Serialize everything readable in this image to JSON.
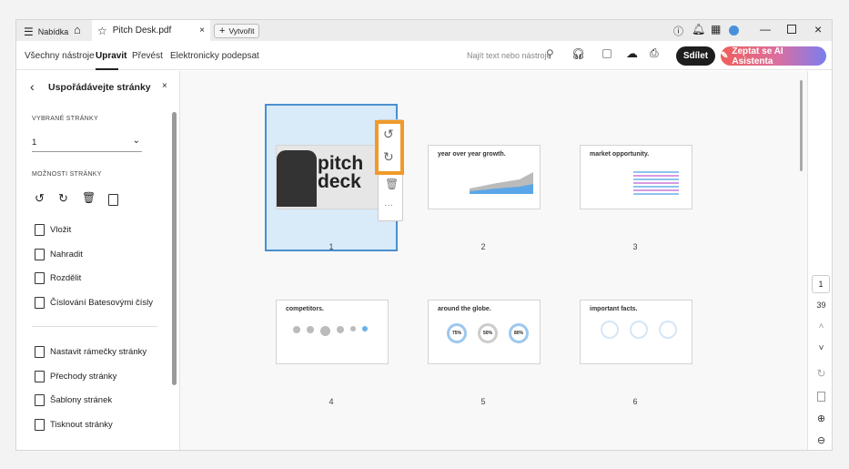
{
  "titlebar": {
    "menu_label": "Nabídka",
    "tab_title": "Pitch Desk.pdf",
    "create_label": "Vytvořit"
  },
  "toolbar": {
    "tabs": [
      "Všechny nástroje",
      "Upravit",
      "Převést",
      "Elektronicky podepsat"
    ],
    "active_tab": "Upravit",
    "search_placeholder": "Najít text nebo nástroje",
    "share_label": "Sdílet",
    "ai_label": "Zeptat se AI Asistenta",
    "ai_color": "#e8605a"
  },
  "panel": {
    "title": "Uspořádávejte stránky",
    "selected_label": "VYBRANÉ STRÁNKY",
    "selected_value": "1",
    "options_label": "MOŽNOSTI STRÁNKY",
    "items": [
      "Vložit",
      "Nahradit",
      "Rozdělit",
      "Číslování Batesovými čísly"
    ],
    "items2": [
      "Nastavit rámečky stránky",
      "Přechody stránky",
      "Šablony stránek",
      "Tisknout stránky"
    ]
  },
  "pages": [
    {
      "num": "1",
      "title": "pitch deck"
    },
    {
      "num": "2",
      "title": "year over year growth."
    },
    {
      "num": "3",
      "title": "market opportunity."
    },
    {
      "num": "4",
      "title": "competitors."
    },
    {
      "num": "5",
      "title": "around the globe.",
      "values": [
        "75%",
        "50%",
        "80%"
      ]
    },
    {
      "num": "6",
      "title": "important facts."
    }
  ],
  "rail": {
    "current_page": "1",
    "total_pages": "39"
  }
}
